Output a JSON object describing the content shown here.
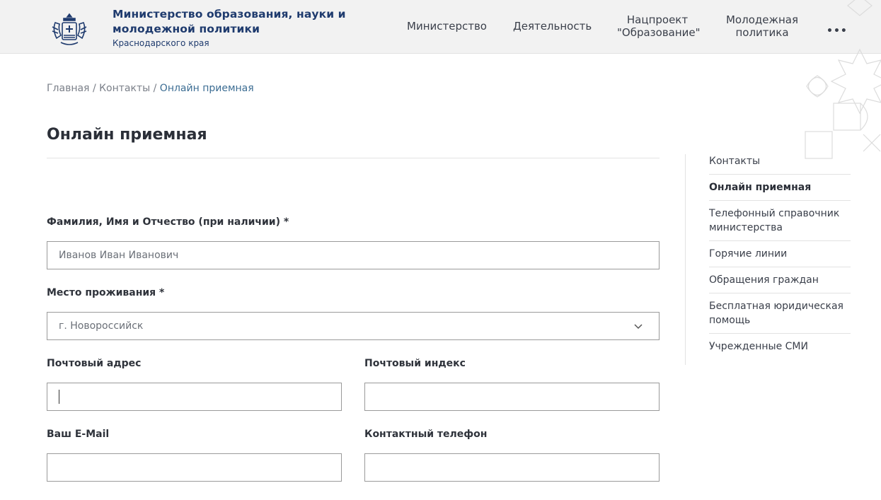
{
  "header": {
    "org_line1": "Министерство образования, науки и",
    "org_line2": "молодежной политики",
    "org_sub": "Краснодарского края",
    "nav": [
      {
        "line1": "Министерство",
        "line2": ""
      },
      {
        "line1": "Деятельность",
        "line2": ""
      },
      {
        "line1": "Нацпроект",
        "line2": "\"Образование\""
      },
      {
        "line1": "Молодежная",
        "line2": "политика"
      }
    ],
    "more": "•••"
  },
  "breadcrumb": {
    "home": "Главная",
    "sep": "/",
    "contacts": "Контакты",
    "current": "Онлайн приемная"
  },
  "page": {
    "title": "Онлайн приемная"
  },
  "form": {
    "fio_label": "Фамилия, Имя и Отчество (при наличии) *",
    "fio_value": "Иванов Иван Иванович",
    "residence_label": "Место проживания *",
    "residence_value": "г. Новороссийск",
    "postal_address_label": "Почтовый адрес",
    "postal_index_label": "Почтовый индекс",
    "email_label": "Ваш E-Mail",
    "phone_label": "Контактный телефон"
  },
  "sidebar": {
    "items": [
      {
        "line1": "Контакты",
        "line2": ""
      },
      {
        "line1": "Онлайн приемная",
        "line2": ""
      },
      {
        "line1": "Телефонный справочник",
        "line2": "министерства"
      },
      {
        "line1": "Горячие линии",
        "line2": ""
      },
      {
        "line1": "Обращения граждан",
        "line2": ""
      },
      {
        "line1": "Бесплатная юридическая",
        "line2": "помощь"
      },
      {
        "line1": "Учрежденные СМИ",
        "line2": ""
      }
    ]
  }
}
